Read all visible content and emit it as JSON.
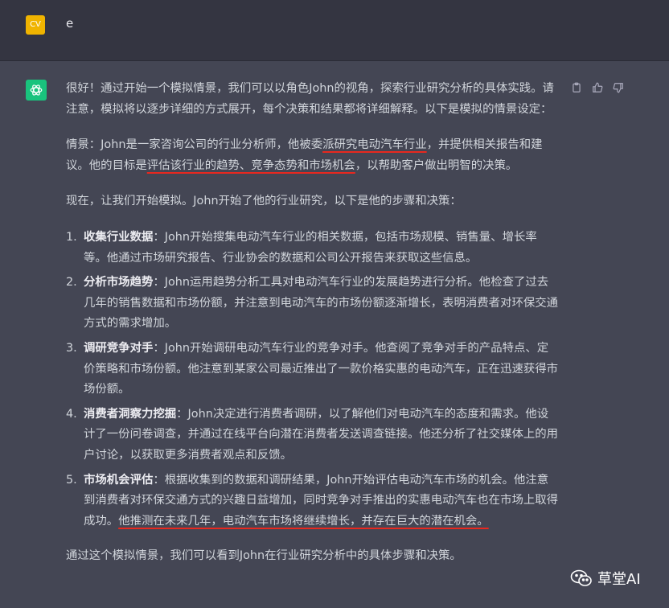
{
  "user": {
    "avatar_initials": "CV",
    "message": "e"
  },
  "assistant": {
    "intro": "很好！通过开始一个模拟情景，我们可以以角色John的视角，探索行业研究分析的具体实践。请注意，模拟将以逐步详细的方式展开，每个决策和结果都将详细解释。以下是模拟的情景设定：",
    "scenario": {
      "p1": "情景：John是一家咨询公司的行业分析师，他被委",
      "hl1": "派研究电动汽车行业",
      "p2": "，并提供相关报告和建议。他的目标是",
      "hl2": "评估该行业的趋势、竞争态势和市场机会",
      "p3": "，以帮助客户做出明智的决策。"
    },
    "lead_in": "现在，让我们开始模拟。John开始了他的行业研究，以下是他的步骤和决策：",
    "steps": [
      {
        "num": "1.",
        "title": "收集行业数据",
        "text": "：John开始搜集电动汽车行业的相关数据，包括市场规模、销售量、增长率等。他通过市场研究报告、行业协会的数据和公司公开报告来获取这些信息。"
      },
      {
        "num": "2.",
        "title": "分析市场趋势",
        "text": "：John运用趋势分析工具对电动汽车行业的发展趋势进行分析。他检查了过去几年的销售数据和市场份额，并注意到电动汽车的市场份额逐渐增长，表明消费者对环保交通方式的需求增加。"
      },
      {
        "num": "3.",
        "title": "调研竞争对手",
        "text": "：John开始调研电动汽车行业的竞争对手。他查阅了竞争对手的产品特点、定价策略和市场份额。他注意到某家公司最近推出了一款价格实惠的电动汽车，正在迅速获得市场份额。"
      },
      {
        "num": "4.",
        "title": "消费者洞察力挖掘",
        "text": "：John决定进行消费者调研，以了解他们对电动汽车的态度和需求。他设计了一份问卷调查，并通过在线平台向潜在消费者发送调查链接。他还分析了社交媒体上的用户讨论，以获取更多消费者观点和反馈。"
      },
      {
        "num": "5.",
        "title": "市场机会评估",
        "text": "：根据收集到的数据和调研结果，John开始评估电动汽车市场的机会。他注意到消费者对环保交通方式的兴趣日益增加，同时竞争对手推出的实惠电动汽车也在市场上取得成功。",
        "highlight": "他推测在未来几年，电动汽车市场将继续增长，并存在巨大的潜在机会。"
      }
    ],
    "conclusion": "通过这个模拟情景，我们可以看到John在行业研究分析中的具体步骤和决策。"
  },
  "watermark": "草堂AI",
  "colors": {
    "highlight_underline": "#e8281f",
    "bot_avatar": "#19c37d",
    "user_avatar": "#f0b400"
  }
}
